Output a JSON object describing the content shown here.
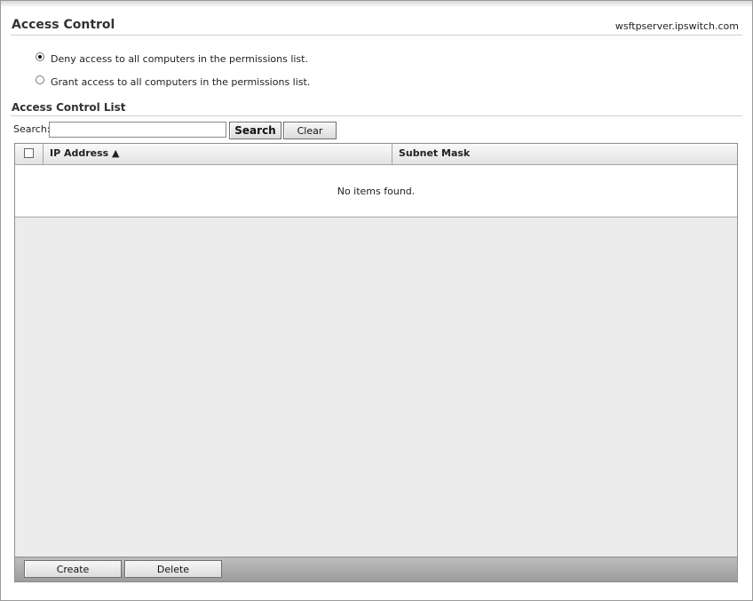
{
  "header": {
    "title": "Access Control",
    "server": "wsftpserver.ipswitch.com"
  },
  "access_options": [
    {
      "label": "Deny access to all computers in the permissions list.",
      "selected": true
    },
    {
      "label": "Grant access to all computers in the permissions list.",
      "selected": false
    }
  ],
  "acl": {
    "title": "Access Control List",
    "search_label": "Search:",
    "search_value": "",
    "search_button": "Search",
    "clear_button": "Clear",
    "columns": {
      "ip": "IP Address ▲",
      "subnet": "Subnet Mask"
    },
    "empty_message": "No items found.",
    "create_button": "Create",
    "delete_button": "Delete"
  }
}
